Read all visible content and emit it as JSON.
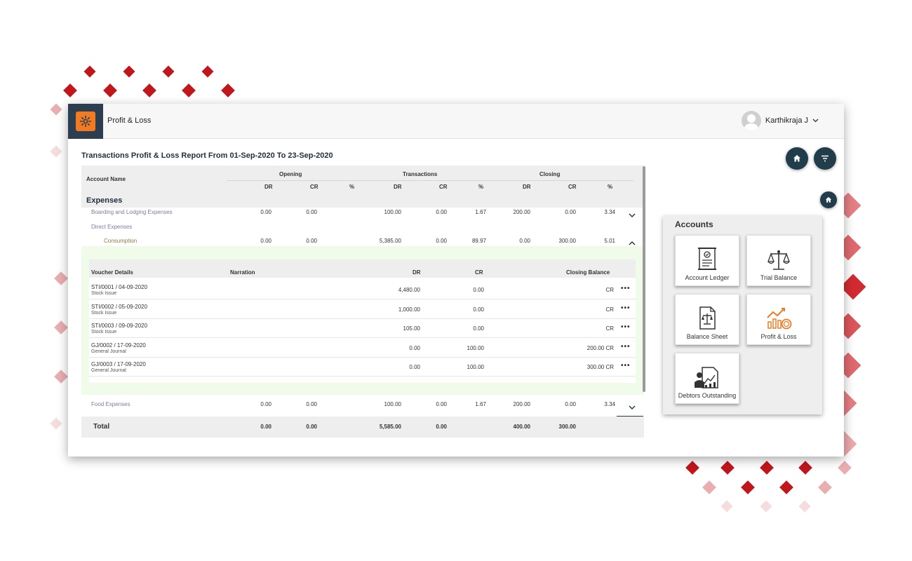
{
  "app": {
    "title": "Profit & Loss"
  },
  "user": {
    "name": "Karthikraja J"
  },
  "report": {
    "title": "Transactions Profit & Loss Report From 01-Sep-2020 To 23-Sep-2020"
  },
  "table": {
    "account_name": "Account Name",
    "groups": [
      "Opening",
      "Transactions",
      "Closing"
    ],
    "subcols": [
      "DR",
      "CR",
      "%",
      "DR",
      "CR",
      "%",
      "DR",
      "CR",
      "%"
    ],
    "section": "Expenses",
    "rows": [
      {
        "name": "Boarding and Lodging Expenses",
        "values": [
          "0.00",
          "0.00",
          "",
          "100.00",
          "0.00",
          "1.67",
          "200.00",
          "0.00",
          "3.34"
        ]
      },
      {
        "name": "Direct Expenses",
        "values": [
          "",
          "",
          "",
          "",
          "",
          "",
          "",
          "",
          ""
        ]
      },
      {
        "name": "Consumption",
        "values": [
          "0.00",
          "0.00",
          "",
          "5,385.00",
          "0.00",
          "89.97",
          "0.00",
          "300.00",
          "5.01"
        ]
      },
      {
        "name": "Food Expenses",
        "values": [
          "0.00",
          "0.00",
          "",
          "100.00",
          "0.00",
          "1.67",
          "200.00",
          "0.00",
          "3.34"
        ]
      }
    ],
    "total": {
      "label": "Total",
      "values": [
        "0.00",
        "0.00",
        "",
        "5,585.00",
        "0.00",
        "",
        "400.00",
        "300.00",
        ""
      ]
    }
  },
  "vouchers": {
    "headers": {
      "details": "Voucher Details",
      "narration": "Narration",
      "dr": "DR",
      "cr": "CR",
      "closing": "Closing Balance"
    },
    "rows": [
      {
        "id": "STI/0001 / 04-09-2020",
        "type": "Stock Issue",
        "dr": "4,480.00",
        "cr": "0.00",
        "closing": "CR"
      },
      {
        "id": "STI/0002 / 05-09-2020",
        "type": "Stock Issue",
        "dr": "1,000.00",
        "cr": "0.00",
        "closing": "CR"
      },
      {
        "id": "STI/0003 / 09-09-2020",
        "type": "Stock Issue",
        "dr": "105.00",
        "cr": "0.00",
        "closing": "CR"
      },
      {
        "id": "GJ/0002 / 17-09-2020",
        "type": "General Journal",
        "dr": "0.00",
        "cr": "100.00",
        "closing": "200.00 CR"
      },
      {
        "id": "GJ/0003 / 17-09-2020",
        "type": "General Journal",
        "dr": "0.00",
        "cr": "100.00",
        "closing": "300.00 CR"
      }
    ],
    "more": "•••"
  },
  "accounts": {
    "title": "Accounts",
    "tiles": [
      {
        "label": "Account Ledger",
        "icon": "ledger-icon"
      },
      {
        "label": "Trial Balance",
        "icon": "scale-icon"
      },
      {
        "label": "Balance Sheet",
        "icon": "balance-sheet-icon"
      },
      {
        "label": "Profit & Loss",
        "icon": "profit-loss-icon"
      },
      {
        "label": "Debtors Outstanding",
        "icon": "debtors-icon"
      }
    ]
  },
  "colors": {
    "primary": "#213c4a",
    "accent": "#f07b22",
    "decor": "#c0161c",
    "detail_bg": "#f0fbe9"
  }
}
